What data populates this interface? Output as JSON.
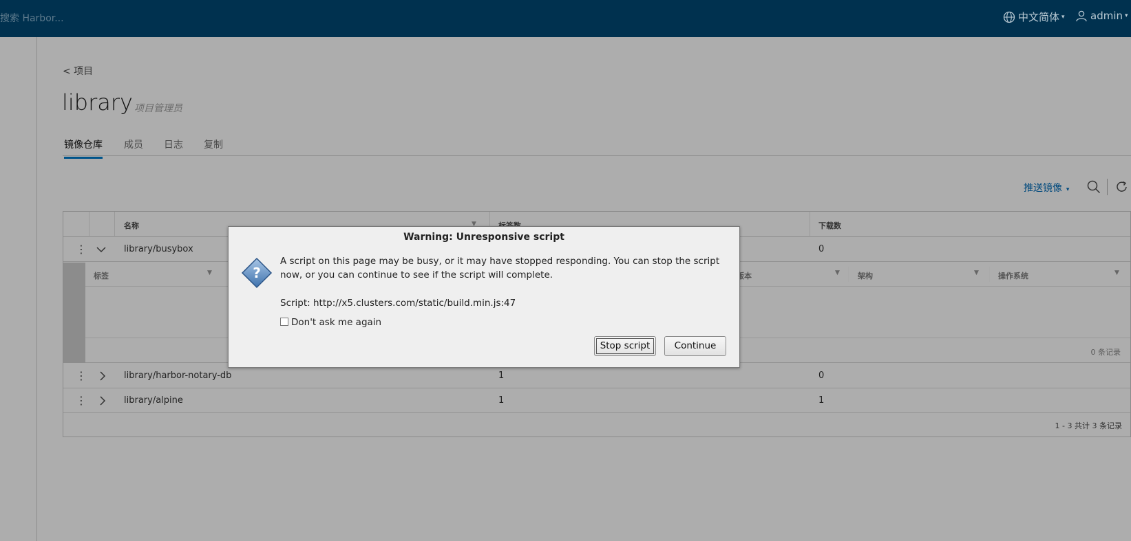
{
  "header": {
    "search_placeholder": "搜索 Harbor...",
    "language": "中文简体",
    "user": "admin"
  },
  "breadcrumb": {
    "back": "< 项目"
  },
  "project": {
    "name": "library",
    "role": "项目管理员"
  },
  "tabs": [
    {
      "label": "镜像仓库",
      "active": true
    },
    {
      "label": "成员",
      "active": false
    },
    {
      "label": "日志",
      "active": false
    },
    {
      "label": "复制",
      "active": false
    }
  ],
  "toolbar": {
    "push_image": "推送镜像"
  },
  "grid": {
    "columns": [
      "名称",
      "标签数",
      "下载数"
    ],
    "rows": [
      {
        "name": "library/busybox",
        "tags": "",
        "pulls": "0",
        "expanded": true
      },
      {
        "name": "library/harbor-notary-db",
        "tags": "1",
        "pulls": "0",
        "expanded": false
      },
      {
        "name": "library/alpine",
        "tags": "1",
        "pulls": "1",
        "expanded": false
      }
    ],
    "sub_columns": [
      "标签",
      "版本",
      "架构",
      "操作系统"
    ],
    "sub_footer": "0 条记录",
    "footer": "1 - 3 共计 3 条记录"
  },
  "dialog": {
    "title": "Warning: Unresponsive script",
    "message": "A script on this page may be busy, or it may have stopped responding. You can stop the script now, or you can continue to see if the script will complete.",
    "script": "Script: http://x5.clusters.com/static/build.min.js:47",
    "checkbox_label": "Don't ask me again",
    "stop_label": "Stop script",
    "continue_label": "Continue"
  },
  "colors": {
    "header": "#00314f",
    "accent": "#00548a",
    "overlay": "#adadad"
  }
}
